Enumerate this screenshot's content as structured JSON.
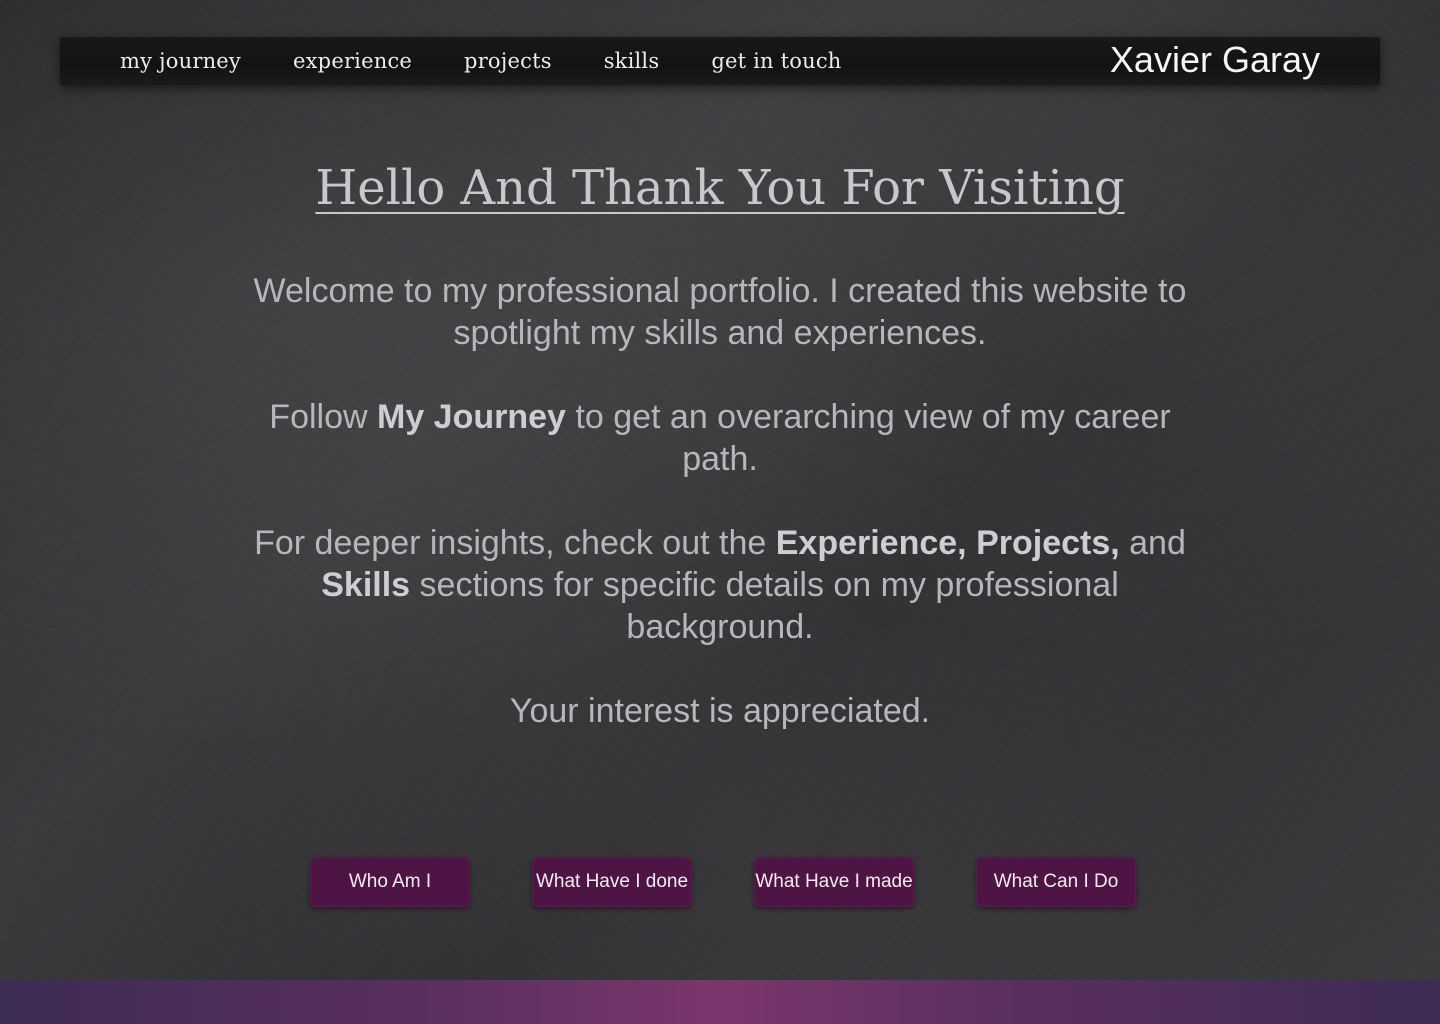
{
  "nav": {
    "links": [
      "my journey",
      "experience",
      "projects",
      "skills",
      "get in touch"
    ],
    "brand": "Xavier Garay"
  },
  "hero": {
    "title": "Hello And Thank You For Visiting"
  },
  "intro": {
    "p1": "Welcome to my professional portfolio. I created this website to spotlight my skills and experiences.",
    "p2_pre": "Follow ",
    "p2_bold": "My Journey",
    "p2_post": " to get an overarching view of my career path.",
    "p3_pre": "For deeper insights, check out the ",
    "p3_bold1": "Experience, Projects,",
    "p3_mid": " and ",
    "p3_bold2": "Skills",
    "p3_post": " sections for specific details on my professional background.",
    "p4": "Your interest is appreciated."
  },
  "buttons": [
    "Who Am I",
    "What Have I done",
    "What Have I made",
    "What Can I Do"
  ],
  "colors": {
    "button_bg": "#4e1443",
    "nav_bg": "#141315",
    "footer_accent": "#7a366d"
  }
}
